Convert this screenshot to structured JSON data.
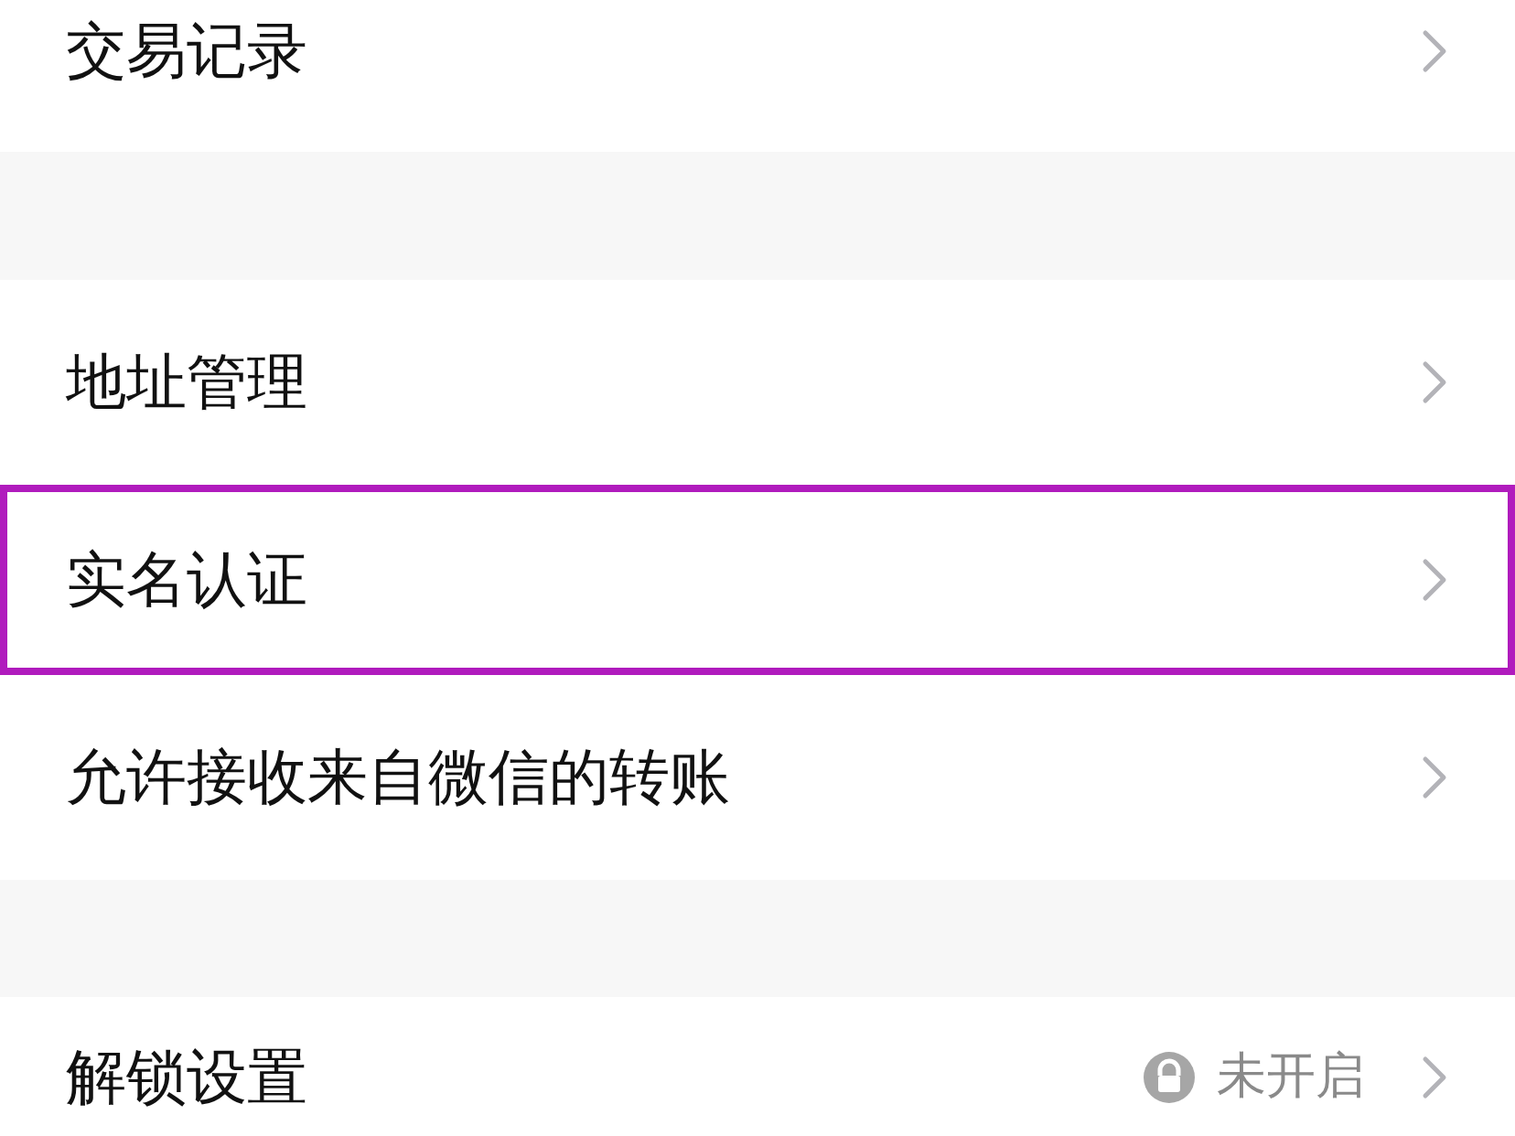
{
  "groups": [
    {
      "items": [
        {
          "label": "交易记录",
          "highlighted": false
        }
      ]
    },
    {
      "items": [
        {
          "label": "地址管理",
          "highlighted": false
        },
        {
          "label": "实名认证",
          "highlighted": true
        },
        {
          "label": "允许接收来自微信的转账",
          "highlighted": false
        }
      ]
    },
    {
      "items": [
        {
          "label": "解锁设置",
          "highlighted": false,
          "status": "未开启",
          "locked": true
        }
      ]
    }
  ]
}
